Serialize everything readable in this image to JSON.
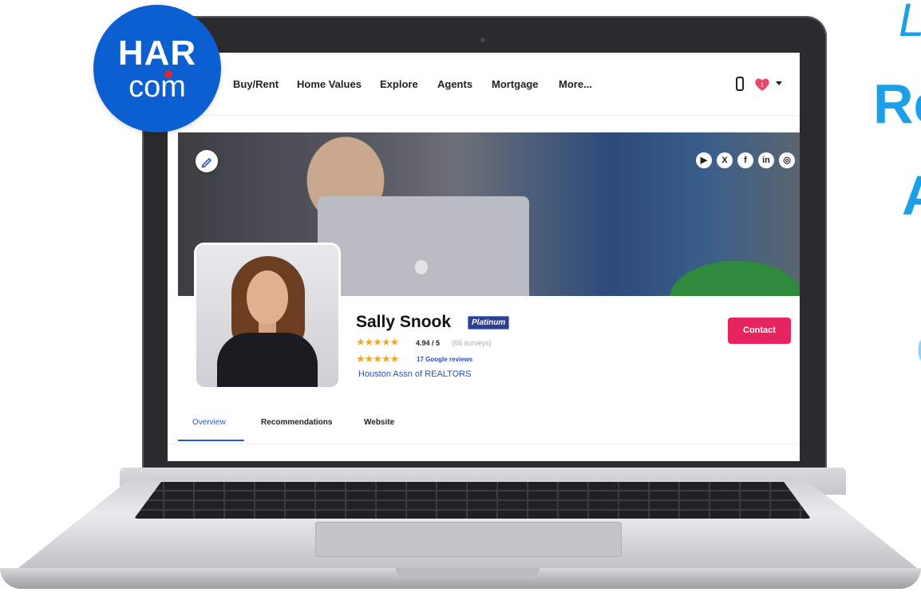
{
  "logo": {
    "line1": "HAR",
    "line2": "com"
  },
  "headline": {
    "line1": "L",
    "line2": "Re",
    "line3": "A",
    "line4": "C"
  },
  "nav": {
    "items": [
      "Buy/Rent",
      "Home Values",
      "Explore",
      "Agents",
      "Mortgage",
      "More..."
    ],
    "heart_count": "1"
  },
  "social_icons": [
    "youtube-icon",
    "x-icon",
    "facebook-icon",
    "linkedin-icon",
    "instagram-icon"
  ],
  "social_glyphs": [
    "▶",
    "X",
    "f",
    "in",
    "◎"
  ],
  "profile": {
    "name": "Sally Snook",
    "badge": "Platinum",
    "rating": "4.94 / 5",
    "surveys": "(66 surveys)",
    "google_reviews": "17 Google reviews",
    "association": "Houston Assn of REALTORS",
    "contact_label": "Contact"
  },
  "tabs": [
    "Overview",
    "Recommendations",
    "Website"
  ],
  "colors": {
    "brand_blue": "#0c5fd0",
    "accent_pink": "#e6245f",
    "link_blue": "#2a50c8",
    "star": "#f5a623"
  }
}
